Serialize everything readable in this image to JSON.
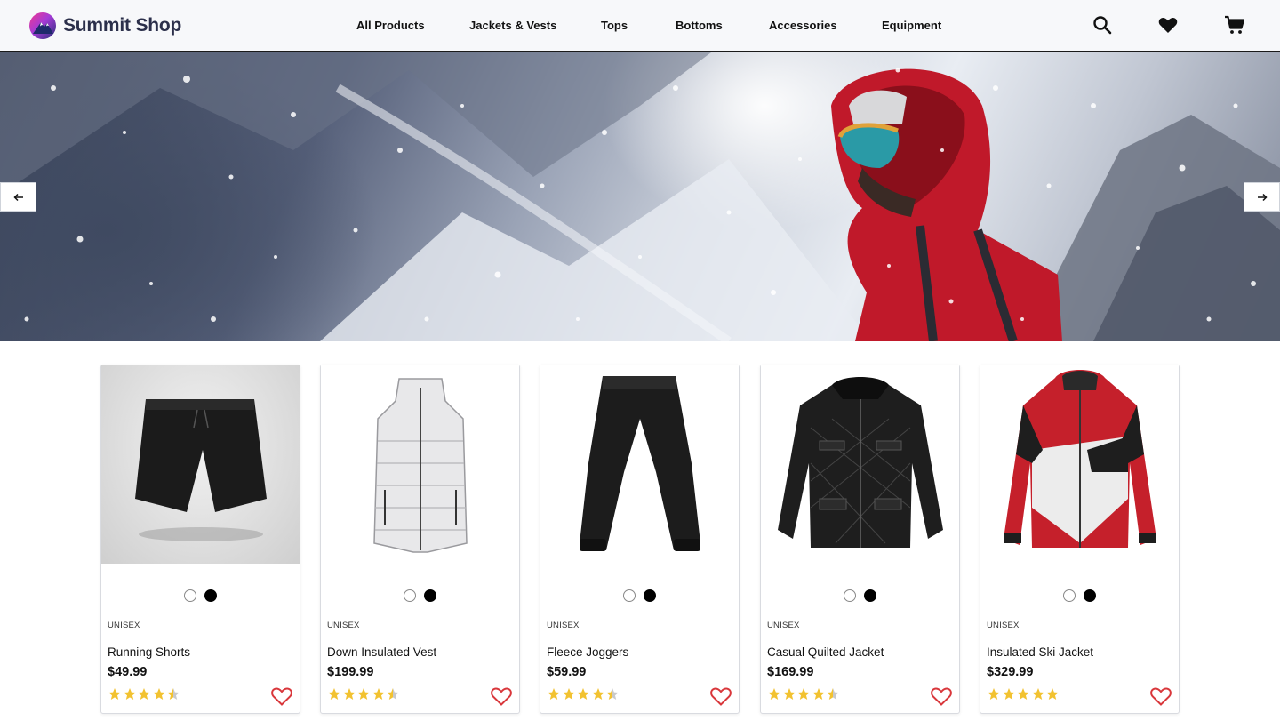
{
  "brand": {
    "name": "Summit Shop",
    "logo_icon": "mountain-logo-icon"
  },
  "nav": {
    "items": [
      "All Products",
      "Jackets & Vests",
      "Tops",
      "Bottoms",
      "Accessories",
      "Equipment"
    ]
  },
  "header_icons": [
    "search-icon",
    "heart-icon",
    "cart-icon"
  ],
  "hero": {
    "prev_icon": "arrow-left-icon",
    "next_icon": "arrow-right-icon"
  },
  "colors": {
    "star": "#f2c230",
    "star_empty": "#c9c9c9",
    "heart": "#d9373b",
    "header_border": "#1a1a1a"
  },
  "products": [
    {
      "gender": "UNISEX",
      "name": "Running Shorts",
      "price": "$49.99",
      "rating": 4.5,
      "swatches": [
        "white",
        "black"
      ]
    },
    {
      "gender": "UNISEX",
      "name": "Down Insulated Vest",
      "price": "$199.99",
      "rating": 4.5,
      "swatches": [
        "white",
        "black"
      ]
    },
    {
      "gender": "UNISEX",
      "name": "Fleece Joggers",
      "price": "$59.99",
      "rating": 4.5,
      "swatches": [
        "white",
        "black"
      ]
    },
    {
      "gender": "UNISEX",
      "name": "Casual Quilted Jacket",
      "price": "$169.99",
      "rating": 4.5,
      "swatches": [
        "white",
        "black"
      ]
    },
    {
      "gender": "UNISEX",
      "name": "Insulated Ski Jacket",
      "price": "$329.99",
      "rating": 5,
      "swatches": [
        "white",
        "black"
      ]
    }
  ]
}
